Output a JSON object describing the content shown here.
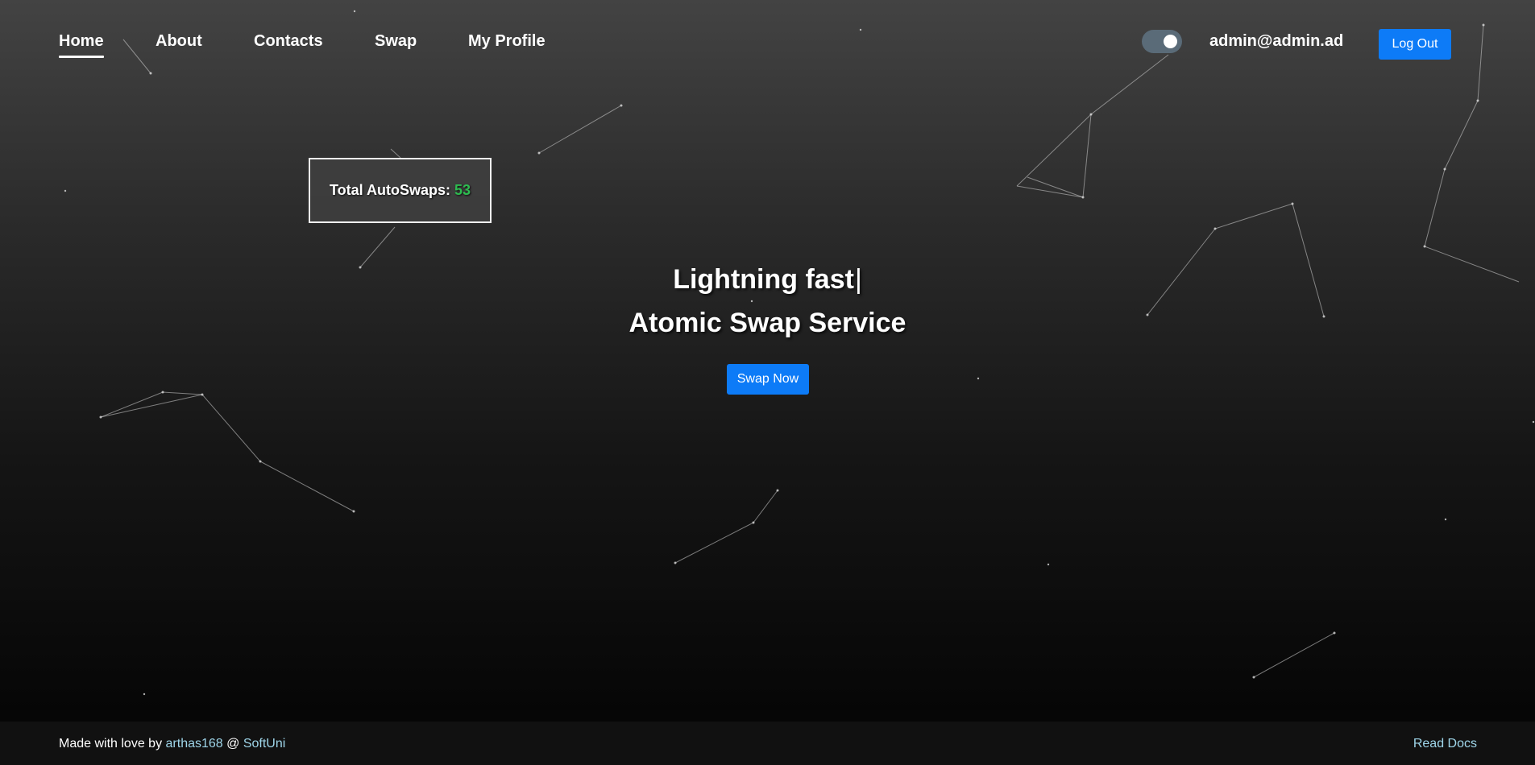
{
  "nav": {
    "items": [
      {
        "label": "Home",
        "active": true
      },
      {
        "label": "About",
        "active": false
      },
      {
        "label": "Contacts",
        "active": false
      },
      {
        "label": "Swap",
        "active": false
      },
      {
        "label": "My Profile",
        "active": false
      }
    ],
    "theme_toggle_on": true,
    "user_email": "admin@admin.ad",
    "logout_label": "Log Out"
  },
  "stats": {
    "label": "Total AutoSwaps:",
    "count": "53"
  },
  "hero": {
    "line1": "Lightning fast",
    "cursor": "|",
    "line2": "Atomic Swap Service",
    "cta_label": "Swap Now"
  },
  "footer": {
    "made_with": "Made with love by",
    "author": "arthas168",
    "at": "@",
    "org": "SoftUni",
    "docs_label": "Read Docs"
  },
  "colors": {
    "primary": "#0d7bf7",
    "count_green": "#2dbb4f",
    "link": "#9fd6ea",
    "toggle": "#5a6b78",
    "footer_bg": "#111111"
  }
}
